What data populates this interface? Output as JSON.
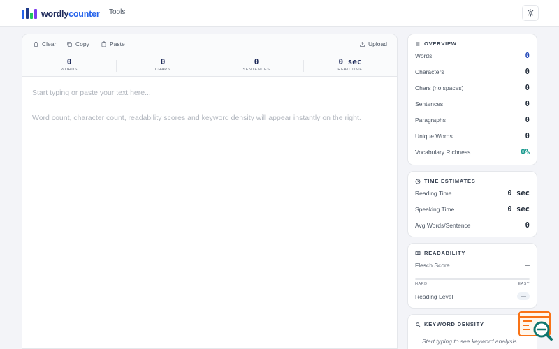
{
  "header": {
    "logo_part1": "wordly",
    "logo_part2": "counter",
    "logo_colors": [
      "#2563eb",
      "#1e3a8a",
      "#22c55e",
      "#7c3aed"
    ],
    "nav_tools": "Tools",
    "theme_icon": "sun-icon"
  },
  "editor": {
    "toolbar": {
      "clear": "Clear",
      "copy": "Copy",
      "paste": "Paste",
      "upload": "Upload"
    },
    "stats": [
      {
        "value": "0",
        "label": "WORDS"
      },
      {
        "value": "0",
        "label": "CHARS"
      },
      {
        "value": "0",
        "label": "SENTENCES"
      },
      {
        "value": "0 sec",
        "label": "READ TIME"
      }
    ],
    "placeholder_line1": "Start typing or paste your text here...",
    "placeholder_line2": "Word count, character count, readability scores and keyword density will appear instantly on the right."
  },
  "overview": {
    "title": "OVERVIEW",
    "rows": [
      {
        "label": "Words",
        "value": "0"
      },
      {
        "label": "Characters",
        "value": "0"
      },
      {
        "label": "Chars (no spaces)",
        "value": "0"
      },
      {
        "label": "Sentences",
        "value": "0"
      },
      {
        "label": "Paragraphs",
        "value": "0"
      },
      {
        "label": "Unique Words",
        "value": "0"
      },
      {
        "label": "Vocabulary Richness",
        "value": "0%"
      }
    ]
  },
  "time_estimates": {
    "title": "TIME ESTIMATES",
    "rows": [
      {
        "label": "Reading Time",
        "value": "0 sec"
      },
      {
        "label": "Speaking Time",
        "value": "0 sec"
      },
      {
        "label": "Avg Words/Sentence",
        "value": "0"
      }
    ]
  },
  "readability": {
    "title": "READABILITY",
    "flesch_label": "Flesch Score",
    "flesch_value": "–",
    "hard_label": "HARD",
    "easy_label": "EASY",
    "level_label": "Reading Level",
    "level_value": "—"
  },
  "keyword_density": {
    "title": "KEYWORD DENSITY",
    "empty_text": "Start typing to see keyword analysis"
  },
  "colors": {
    "accent": "#2563eb",
    "navy": "#1e2a5a",
    "teal": "#0d9488",
    "float_orange": "#f97316",
    "float_teal": "#0f766e"
  }
}
